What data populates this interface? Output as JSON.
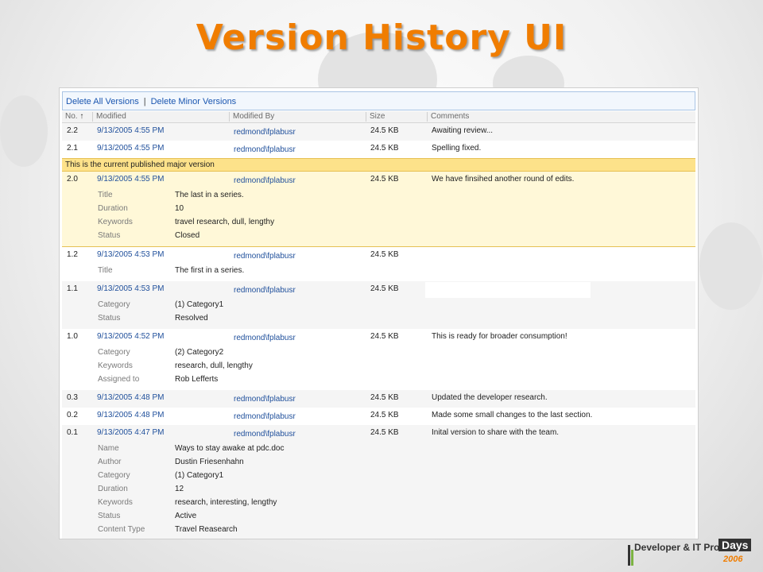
{
  "slide": {
    "title": "Version History UI"
  },
  "toolbar": {
    "delete_all": "Delete All Versions",
    "separator": "|",
    "delete_minor": "Delete Minor Versions"
  },
  "columns": {
    "no": "No.",
    "sort_arrow": "↑",
    "modified": "Modified",
    "modified_by": "Modified By",
    "size": "Size",
    "comments": "Comments"
  },
  "current_banner": "This is the current published major version",
  "versions": [
    {
      "no": "2.2",
      "modified": "9/13/2005 4:55 PM",
      "by": "redmond\\fplabusr",
      "size": "24.5 KB",
      "comment": "Awaiting review...",
      "props": []
    },
    {
      "no": "2.1",
      "modified": "9/13/2005 4:55 PM",
      "by": "redmond\\fplabusr",
      "size": "24.5 KB",
      "comment": "Spelling fixed.",
      "props": []
    },
    {
      "no": "2.0",
      "modified": "9/13/2005 4:55 PM",
      "by": "redmond\\fplabusr",
      "size": "24.5 KB",
      "comment": "We have finsihed another round of edits.",
      "props": [
        {
          "label": "Title",
          "value": "The last in a series."
        },
        {
          "label": "Duration",
          "value": "10"
        },
        {
          "label": "Keywords",
          "value": "travel research, dull, lengthy"
        },
        {
          "label": "Status",
          "value": "Closed"
        }
      ]
    },
    {
      "no": "1.2",
      "modified": "9/13/2005 4:53 PM",
      "by": "redmond\\fplabusr",
      "size": "24.5 KB",
      "comment": "",
      "props": [
        {
          "label": "Title",
          "value": "The first in a series."
        }
      ]
    },
    {
      "no": "1.1",
      "modified": "9/13/2005 4:53 PM",
      "by": "redmond\\fplabusr",
      "size": "24.5 KB",
      "comment": "",
      "props": [
        {
          "label": "Category",
          "value": "(1) Category1"
        },
        {
          "label": "Status",
          "value": "Resolved"
        }
      ]
    },
    {
      "no": "1.0",
      "modified": "9/13/2005 4:52 PM",
      "by": "redmond\\fplabusr",
      "size": "24.5 KB",
      "comment": "This is ready for broader consumption!",
      "props": [
        {
          "label": "Category",
          "value": "(2) Category2"
        },
        {
          "label": "Keywords",
          "value": "research, dull, lengthy"
        },
        {
          "label": "Assigned to",
          "value": "Rob Lefferts"
        }
      ]
    },
    {
      "no": "0.3",
      "modified": "9/13/2005 4:48 PM",
      "by": "redmond\\fplabusr",
      "size": "24.5 KB",
      "comment": "Updated the developer research.",
      "props": []
    },
    {
      "no": "0.2",
      "modified": "9/13/2005 4:48 PM",
      "by": "redmond\\fplabusr",
      "size": "24.5 KB",
      "comment": "Made some small changes to the last section.",
      "props": []
    },
    {
      "no": "0.1",
      "modified": "9/13/2005 4:47 PM",
      "by": "redmond\\fplabusr",
      "size": "24.5 KB",
      "comment": "Inital version to share with the team.",
      "props": [
        {
          "label": "Name",
          "value": "Ways to stay awake at pdc.doc"
        },
        {
          "label": "Author",
          "value": "Dustin Friesenhahn"
        },
        {
          "label": "Category",
          "value": "(1) Category1"
        },
        {
          "label": "Duration",
          "value": "12"
        },
        {
          "label": "Keywords",
          "value": "research, interesting, lengthy"
        },
        {
          "label": "Status",
          "value": "Active"
        },
        {
          "label": "Content Type",
          "value": "Travel Reasearch"
        }
      ]
    }
  ],
  "footer": {
    "brand": "Developer & IT Pro",
    "days": "Days",
    "year": "2006"
  }
}
